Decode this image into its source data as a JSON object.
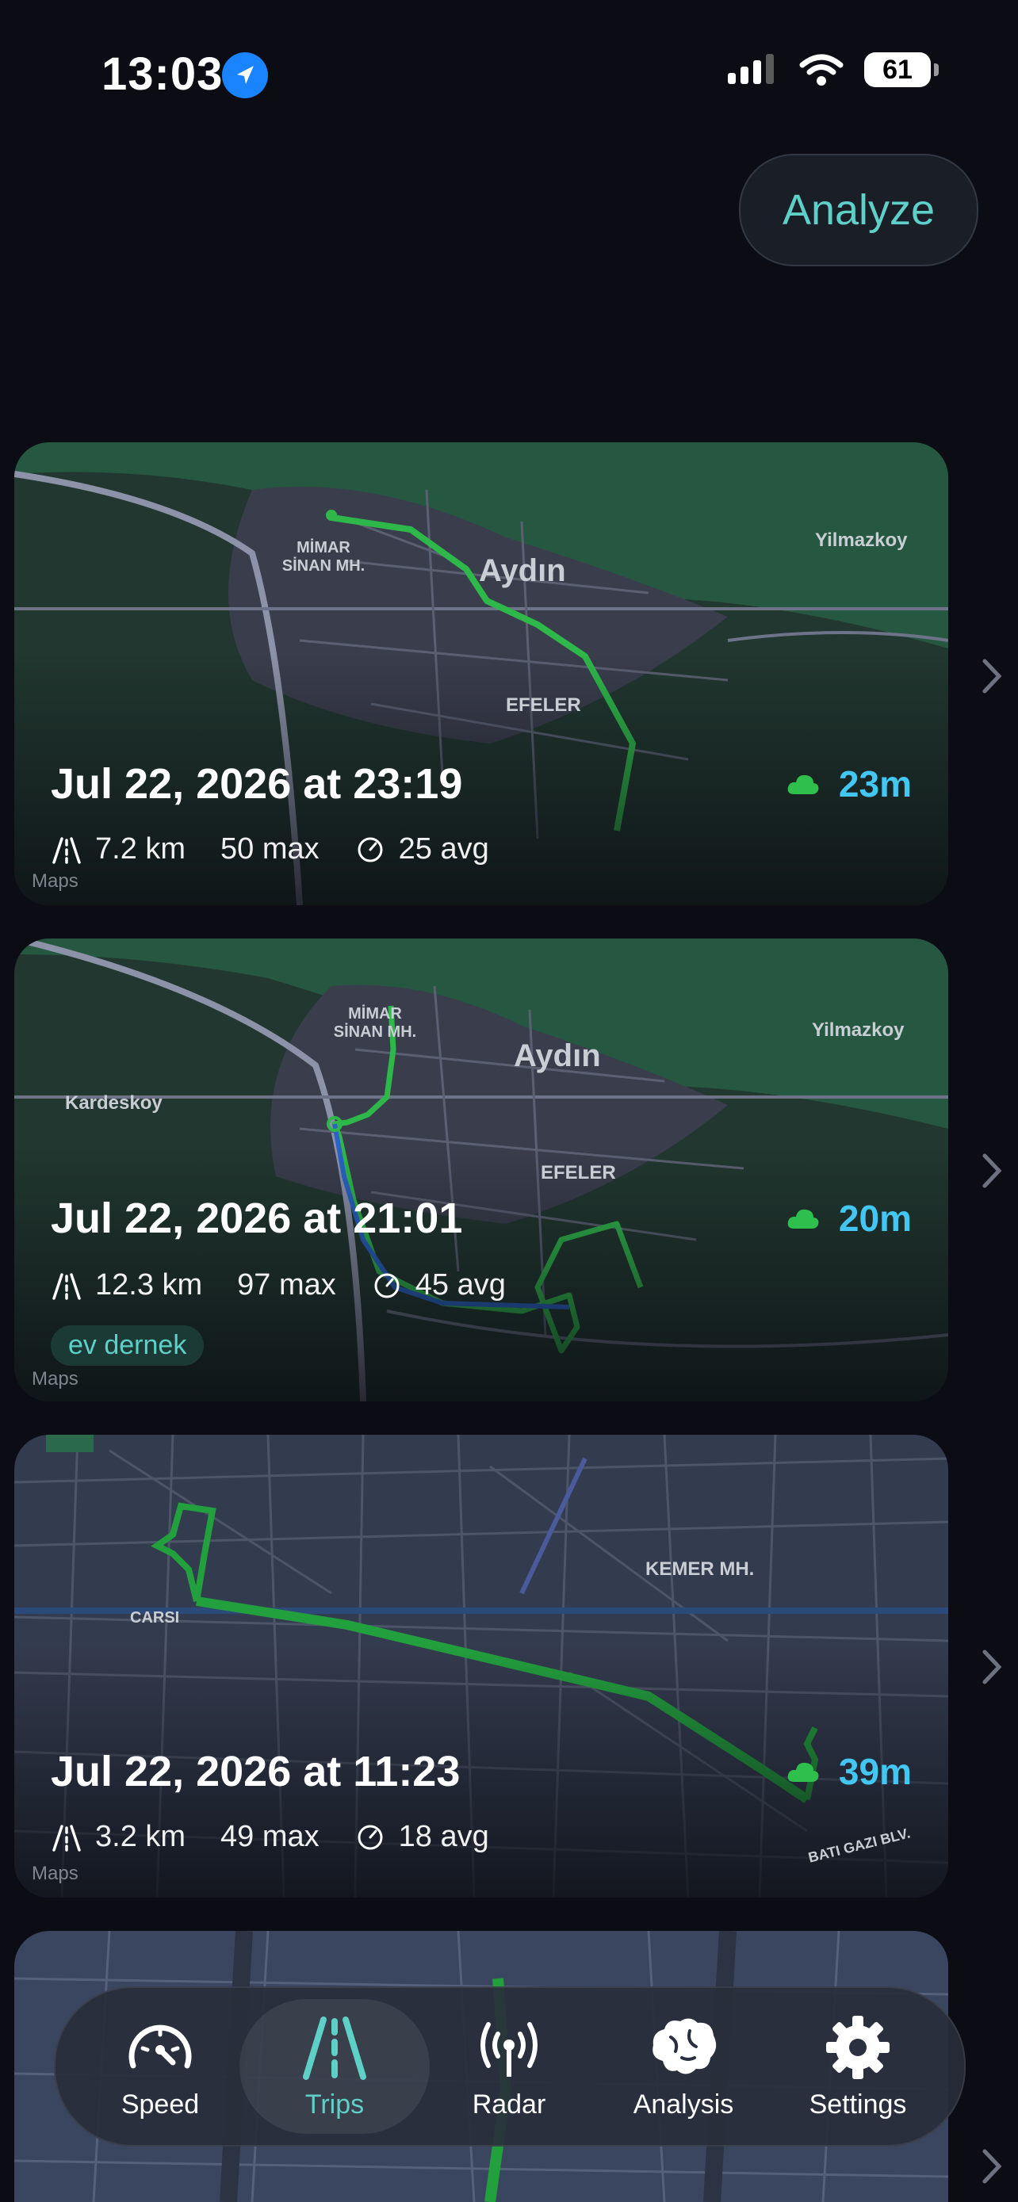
{
  "status_bar": {
    "time": "13:03",
    "battery": "61"
  },
  "header": {
    "analyze_label": "Analyze"
  },
  "trips": [
    {
      "date": "Jul 22, 2026 at 23:19",
      "duration": "23m",
      "distance": "7.2 km",
      "max_speed": "50 max",
      "avg_speed": "25 avg",
      "map_labels": [
        "Aydın",
        "MİMAR SİNAN MH.",
        "EFELER",
        "Yilmazkoy"
      ],
      "attribution": "Maps"
    },
    {
      "date": "Jul 22, 2026 at 21:01",
      "duration": "20m",
      "distance": "12.3 km",
      "max_speed": "97 max",
      "avg_speed": "45 avg",
      "tag": "ev dernek",
      "map_labels": [
        "Aydın",
        "MİMAR SİNAN MH.",
        "EFELER",
        "Yilmazkoy",
        "Kardeskoy"
      ],
      "attribution": "Maps"
    },
    {
      "date": "Jul 22, 2026 at 11:23",
      "duration": "39m",
      "distance": "3.2 km",
      "max_speed": "49 max",
      "avg_speed": "18 avg",
      "map_labels": [
        "KEMER MH.",
        "CARSI",
        "BATI GAZI BLV."
      ],
      "attribution": "Maps"
    }
  ],
  "tab_bar": {
    "tabs": [
      {
        "label": "Speed",
        "icon": "speedometer-icon"
      },
      {
        "label": "Trips",
        "icon": "road-icon",
        "active": true
      },
      {
        "label": "Radar",
        "icon": "radar-icon"
      },
      {
        "label": "Analysis",
        "icon": "brain-icon"
      },
      {
        "label": "Settings",
        "icon": "gear-icon"
      }
    ]
  },
  "colors": {
    "accent": "#5fd0c8",
    "duration": "#44c6f2",
    "route": "#2fb84a",
    "background": "#0b0c14"
  }
}
